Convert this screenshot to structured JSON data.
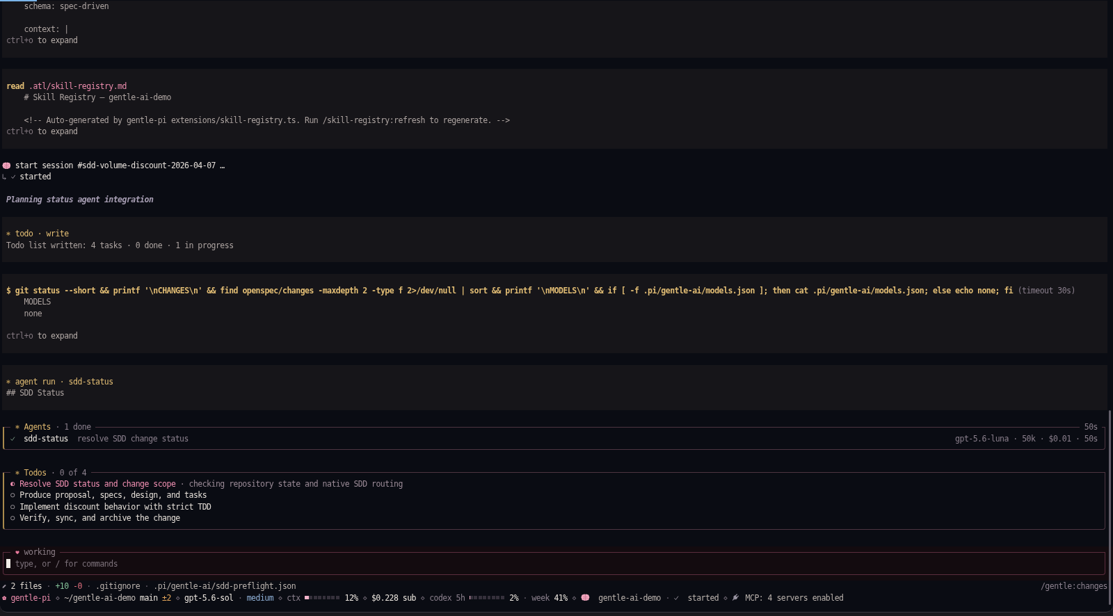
{
  "blocks": [
    {
      "kind": "output",
      "paragraphs": [
        [
          "schema: spec-driven"
        ],
        [
          "context: |"
        ]
      ],
      "hint": {
        "key": "ctrl+o",
        "text": "to expand"
      }
    },
    {
      "kind": "read",
      "verb": "read",
      "path": ".atl/skill-registry.md",
      "paragraphs": [
        [
          "# Skill Registry — gentle-ai-demo"
        ],
        [
          "<!-- Auto-generated by gentle-pi extensions/skill-registry.ts. Run /skill-registry:refresh to regenerate. -->"
        ]
      ],
      "hint": {
        "key": "ctrl+o",
        "text": "to expand"
      }
    },
    {
      "kind": "session",
      "title": "start session #sdd-volume-discount-2026-04-07 …",
      "done": true,
      "result": "started"
    },
    {
      "kind": "thinking",
      "text": "Planning status agent integration"
    },
    {
      "kind": "tool",
      "title": "todo · write",
      "lines": [
        "Todo list written: 4 tasks · 0 done · 1 in progress"
      ]
    },
    {
      "kind": "bash",
      "command": "$ git status --short && printf '\\nCHANGES\\n' && find openspec/changes -maxdepth 2 -type f 2>/dev/null | sort && printf '\\nMODELS\\n' && if [ -f .pi/gentle-ai/models.json ]; then cat .pi/gentle-ai/models.json; else echo none; fi",
      "note": "(timeout 30s)",
      "paragraphs": [
        [
          "MODELS",
          "none"
        ]
      ],
      "blank_before_hint": true,
      "hint": {
        "key": "ctrl+o",
        "text": "to expand"
      }
    },
    {
      "kind": "tool",
      "title": "agent run · sdd-status",
      "lines": [
        "## SDD Status"
      ]
    }
  ],
  "agents_panel": {
    "title": "Agents",
    "summary": "· 1 done",
    "elapsed": "50s",
    "agents": [
      {
        "name": "sdd-status",
        "task": "resolve SDD change status",
        "done": true,
        "meta": "gpt-5.6-luna · 50k · $0.01 · 50s"
      }
    ]
  },
  "todos_panel": {
    "title": "Todos",
    "summary": "· 0 of 4",
    "items": [
      {
        "text": "Resolve SDD status and change scope",
        "detail": "· checking repository state and native SDD routing",
        "active": true
      },
      {
        "text": "Produce proposal, specs, design, and tasks",
        "active": false
      },
      {
        "text": "Implement discount behavior with strict TDD",
        "active": false
      },
      {
        "text": "Verify, sync, and archive the change",
        "active": false
      }
    ]
  },
  "composer": {
    "status": "working",
    "focused": true,
    "placeholder": "type, or / for commands"
  },
  "status_bar": {
    "changes": [
      {
        "kind": "files",
        "text": "2 files"
      },
      {
        "kind": "sep",
        "text": "·"
      },
      {
        "kind": "added",
        "text": "+10"
      },
      {
        "kind": "removed",
        "text": "-0"
      },
      {
        "kind": "sep",
        "text": "·"
      },
      {
        "kind": "file",
        "text": ".gitignore"
      },
      {
        "kind": "sep",
        "text": "·"
      },
      {
        "kind": "file",
        "text": ".pi/gentle-ai/sdd-preflight.json"
      }
    ],
    "shortcut": "/gentle:changes",
    "session": [
      {
        "kind": "app",
        "text": "gentle-pi"
      },
      {
        "kind": "sep",
        "text": "⋄"
      },
      {
        "kind": "path",
        "text": "~/gentle-ai-demo"
      },
      {
        "kind": "branch",
        "text": "main"
      },
      {
        "kind": "dirty",
        "text": "±2"
      },
      {
        "kind": "sep",
        "text": "⋄"
      },
      {
        "kind": "model",
        "text": "gpt-5.6-sol"
      },
      {
        "kind": "sep",
        "text": "·"
      },
      {
        "kind": "effort",
        "text": "medium"
      },
      {
        "kind": "sep",
        "text": "⋄"
      },
      {
        "kind": "label",
        "text": "ctx"
      },
      {
        "kind": "meter",
        "level": 0.12
      },
      {
        "kind": "value",
        "text": "12%"
      },
      {
        "kind": "sep",
        "text": "⋄"
      },
      {
        "kind": "value",
        "text": "$0.228 sub"
      },
      {
        "kind": "sep",
        "text": "⋄"
      },
      {
        "kind": "label",
        "text": "codex 5h"
      },
      {
        "kind": "meter",
        "level": 0.02
      },
      {
        "kind": "value",
        "text": "2%"
      },
      {
        "kind": "sep",
        "text": "·"
      },
      {
        "kind": "label",
        "text": "week"
      },
      {
        "kind": "value",
        "text": "41%"
      },
      {
        "kind": "sep",
        "text": "⋄"
      },
      {
        "kind": "project",
        "text": "gentle-ai-demo"
      },
      {
        "kind": "sep",
        "text": "·"
      },
      {
        "kind": "session",
        "text": "started",
        "done": true
      },
      {
        "kind": "sep",
        "text": "⋄"
      },
      {
        "kind": "mcp",
        "text": "MCP: 4 servers enabled"
      }
    ]
  }
}
